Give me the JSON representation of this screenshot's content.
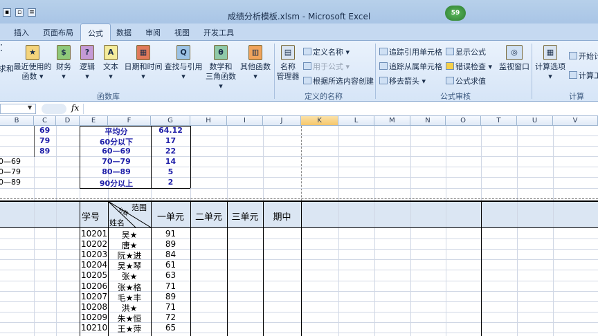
{
  "window": {
    "title": "成绩分析模板.xlsm - Microsoft Excel",
    "badge": "59"
  },
  "tabs": [
    "插入",
    "页面布局",
    "公式",
    "数据",
    "审阅",
    "视图",
    "开发工具"
  ],
  "ribbon": {
    "partial_left": "求和",
    "recent": "最近使用的",
    "recent2": "函数",
    "finance": "财务",
    "logic": "逻辑",
    "text": "文本",
    "datetime": "日期和时间",
    "lookup": "查找与引用",
    "math": "数学和",
    "math2": "三角函数",
    "other": "其他函数",
    "group_lib": "函数库",
    "name_mgr": "名称",
    "name_mgr2": "管理器",
    "define_name": "定义名称",
    "use_in_formula": "用于公式",
    "create_from_sel": "根据所选内容创建",
    "group_names": "定义的名称",
    "trace_prec": "追踪引用单元格",
    "trace_dep": "追踪从属单元格",
    "remove_arrows": "移去箭头",
    "show_formulas": "显示公式",
    "error_check": "错误检查",
    "eval_formula": "公式求值",
    "watch_window": "监视窗口",
    "group_audit": "公式审核",
    "calc_options": "计算选项",
    "calc_now": "开始计",
    "calc_sheet": "计算工",
    "group_calc": "计算",
    "icon_letters": {
      "finance": "$",
      "logic": "?",
      "text": "A",
      "lookup": "Q",
      "math": "θ"
    }
  },
  "formula_bar": {
    "fx": "fx"
  },
  "columns": [
    "B",
    "C",
    "D",
    "E",
    "F",
    "G",
    "H",
    "I",
    "J",
    "K",
    "L",
    "M",
    "N",
    "O",
    "T",
    "U",
    "V"
  ],
  "top_rows": {
    "c_values": [
      "69",
      "79",
      "89"
    ],
    "b_values": [
      "0—69",
      "0—79",
      "0—89"
    ],
    "stats": [
      {
        "label": "平均分",
        "value": "64.12"
      },
      {
        "label": "60分以下",
        "value": "17"
      },
      {
        "label": "60—69",
        "value": "22"
      },
      {
        "label": "70—79",
        "value": "14"
      },
      {
        "label": "80—89",
        "value": "5"
      },
      {
        "label": "90分以上",
        "value": "2"
      }
    ]
  },
  "table_header": {
    "xuehao": "学号",
    "diag_top": "范围",
    "diag_mid": "分数",
    "diag_bottom": "姓名",
    "unit1": "一单元",
    "unit2": "二单元",
    "unit3": "三单元",
    "midterm": "期中"
  },
  "students": [
    {
      "id": "10201",
      "name": "吴★",
      "score": "91"
    },
    {
      "id": "10202",
      "name": "唐★",
      "score": "89"
    },
    {
      "id": "10203",
      "name": "阮★进",
      "score": "84"
    },
    {
      "id": "10204",
      "name": "吴★琴",
      "score": "61"
    },
    {
      "id": "10205",
      "name": "张★",
      "score": "63"
    },
    {
      "id": "10206",
      "name": "张★格",
      "score": "71"
    },
    {
      "id": "10207",
      "name": "毛★丰",
      "score": "89"
    },
    {
      "id": "10208",
      "name": "洪★",
      "score": "71"
    },
    {
      "id": "10209",
      "name": "朱★恒",
      "score": "72"
    },
    {
      "id": "10210",
      "name": "王★萍",
      "score": "65"
    }
  ]
}
